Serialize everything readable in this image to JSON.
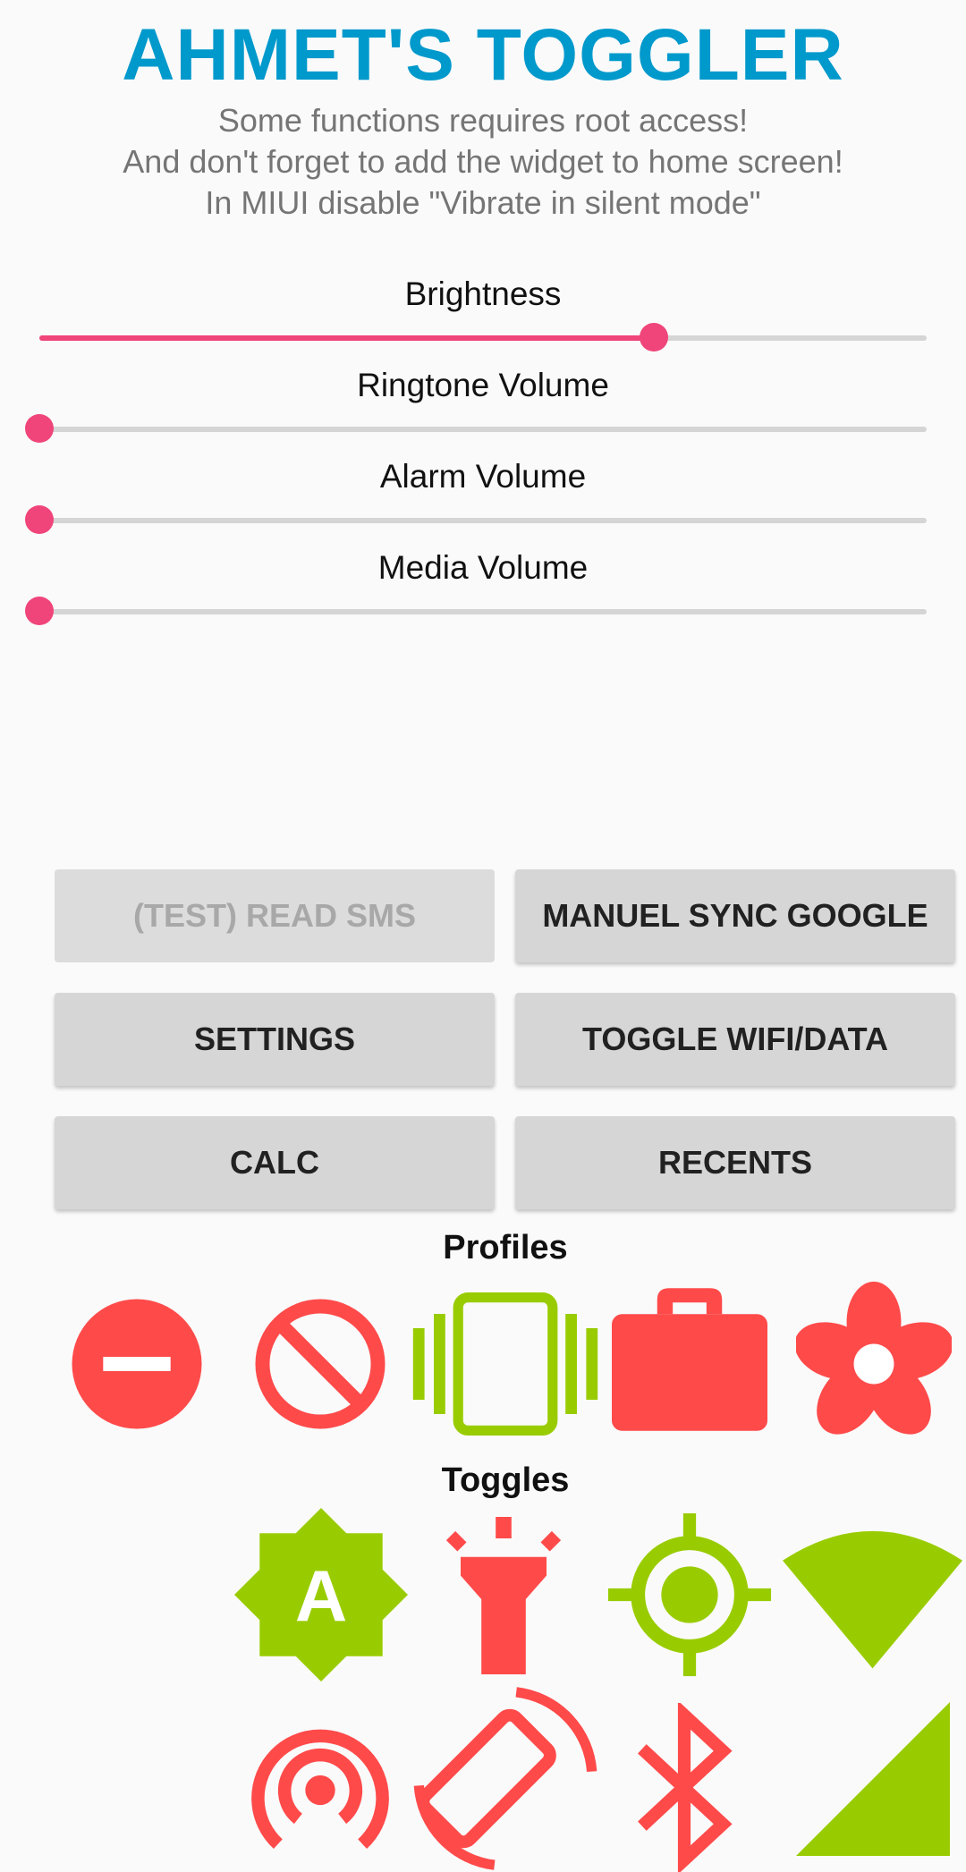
{
  "header": {
    "title": "AHMET'S TOGGLER",
    "notes": [
      "Some functions requires root access!",
      "And don't forget to add the widget to home screen!",
      "In MIUI disable \"Vibrate in silent mode\""
    ]
  },
  "sliders": {
    "brightness": {
      "label": "Brightness",
      "value": 0.693
    },
    "ringtone": {
      "label": "Ringtone Volume",
      "value": 0
    },
    "alarm": {
      "label": "Alarm Volume",
      "value": 0
    },
    "media": {
      "label": "Media Volume",
      "value": 0
    }
  },
  "buttons": {
    "read_sms": "(TEST) READ SMS",
    "manuel_sync": "MANUEL SYNC GOOGLE",
    "settings": "SETTINGS",
    "toggle_wifi_data": "TOGGLE WIFI/DATA",
    "calc": "CALC",
    "recents": "RECENTS"
  },
  "profiles": {
    "title": "Profiles",
    "icons": [
      "do-not-disturb-icon",
      "block-icon",
      "vibrate-icon",
      "work-icon",
      "flower-icon"
    ]
  },
  "toggles": {
    "title": "Toggles",
    "icons": [
      "auto-brightness-icon",
      "flashlight-icon",
      "gps-icon",
      "wifi-icon",
      "hotspot-icon",
      "screen-rotation-icon",
      "bluetooth-icon",
      "mobile-signal-icon"
    ]
  },
  "colors": {
    "title": "#0099cc",
    "accent": "#f0457a",
    "icon_red": "#ff4a4a",
    "icon_green": "#99cc00",
    "button_bg": "#d6d6d6"
  }
}
